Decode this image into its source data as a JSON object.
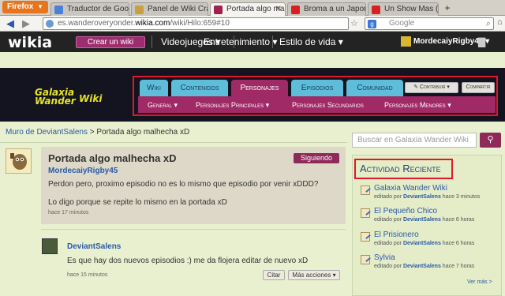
{
  "browser": {
    "firefox_label": "Firefox",
    "tabs": [
      {
        "label": "Traductor de Google",
        "icon_color": "#4a80d8"
      },
      {
        "label": "Panel de Wiki Cras...",
        "icon_color": "#c8a040"
      },
      {
        "label": "Portada algo malh...",
        "icon_color": "#a02050"
      },
      {
        "label": "Broma a un Japoné...",
        "icon_color": "#d82020"
      },
      {
        "label": "Un Show Mas (L...",
        "icon_color": "#d82020"
      }
    ],
    "new_tab": "+",
    "url_prefix": "es.wanderoveryonder.",
    "url_domain": "wikia.com",
    "url_path": "/wiki/Hilo:659#10",
    "google_placeholder": "Google"
  },
  "wikia": {
    "logo": "wikia",
    "create_wiki": "Crear un wiki",
    "nav": [
      "Videojuegos",
      "Entretenimiento",
      "Estilo de vida"
    ],
    "username": "MordecaiyRigby45"
  },
  "wiki": {
    "logo_line1": "Galaxia",
    "logo_line2": "Wander",
    "logo_line3": "Wiki",
    "tabs": [
      "Wiki",
      "Contenidos",
      "Personajes",
      "Episodios",
      "Comunidad"
    ],
    "active_tab": "Personajes",
    "contribuir": "Contribuir",
    "compartir": "Compartir",
    "subnav": [
      "General",
      "Personajes Principales",
      "Personajes Secundarios",
      "Personajes Menores"
    ]
  },
  "thread": {
    "breadcrumb_link": "Muro de DeviantSalens",
    "breadcrumb_sep": ">",
    "breadcrumb_current": "Portada algo malhecha xD",
    "title": "Portada algo malhecha xD",
    "following": "Siguiendo",
    "author": "MordecaiyRigby45",
    "text1": "Perdon pero, proximo episodio no es lo mismo que episodio por venir xDDD?",
    "text2": "Lo digo porque se repite lo mismo en la portada xD",
    "time": "hace 17 minutos"
  },
  "reply": {
    "author": "DeviantSalens",
    "text": "Es que hay dos nuevos episodios :) me da flojera editar de nuevo xD",
    "time": "hace 15 minutos",
    "quote": "Citar",
    "more": "Más acciones"
  },
  "rail": {
    "search_placeholder": "Buscar en Galaxia Wander Wiki",
    "activity_title": "Actividad Reciente",
    "edited_by": "editado por",
    "items": [
      {
        "title": "Galaxia Wander Wiki",
        "user": "DeviantSalens",
        "time": "hace 3 minutos"
      },
      {
        "title": "El Pequeño Chico",
        "user": "DeviantSalens",
        "time": "hace 6 horas"
      },
      {
        "title": "El Prisionero",
        "user": "DeviantSalens",
        "time": "hace 6 horas"
      },
      {
        "title": "Sylvia",
        "user": "DeviantSalens",
        "time": "hace 7 horas"
      }
    ],
    "see_more": "Ver más >"
  }
}
